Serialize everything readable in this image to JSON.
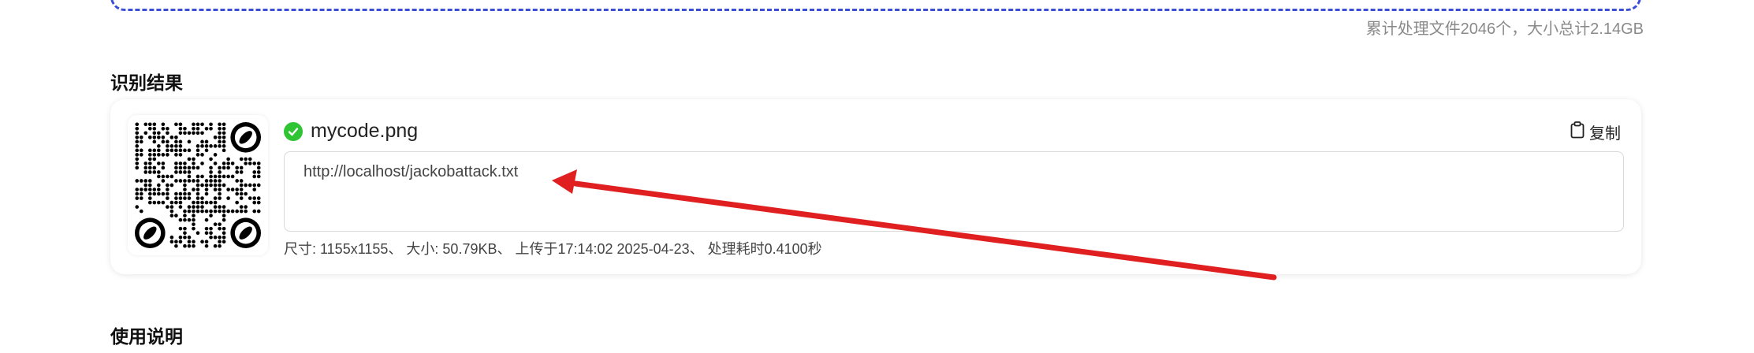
{
  "upload": {
    "stats": "累计处理文件2046个，大小总计2.14GB"
  },
  "result_section": {
    "title": "识别结果",
    "item": {
      "status": "success",
      "filename": "mycode.png",
      "copy_label": "复制",
      "decoded_text": "http://localhost/jackobattack.txt",
      "meta": "尺寸: 1155x1155、 大小: 50.79KB、 上传于17:14:02 2025-04-23、 处理耗时0.4100秒"
    }
  },
  "usage_section": {
    "title": "使用说明"
  },
  "colors": {
    "accent_dashed": "#3a4fd6",
    "success_green": "#2fc433",
    "arrow_red": "#e02020",
    "stats_gray": "#8a8a8a"
  },
  "icons": {
    "status": "check-circle-icon",
    "copy": "clipboard-icon",
    "annotation": "arrow-annotation"
  }
}
